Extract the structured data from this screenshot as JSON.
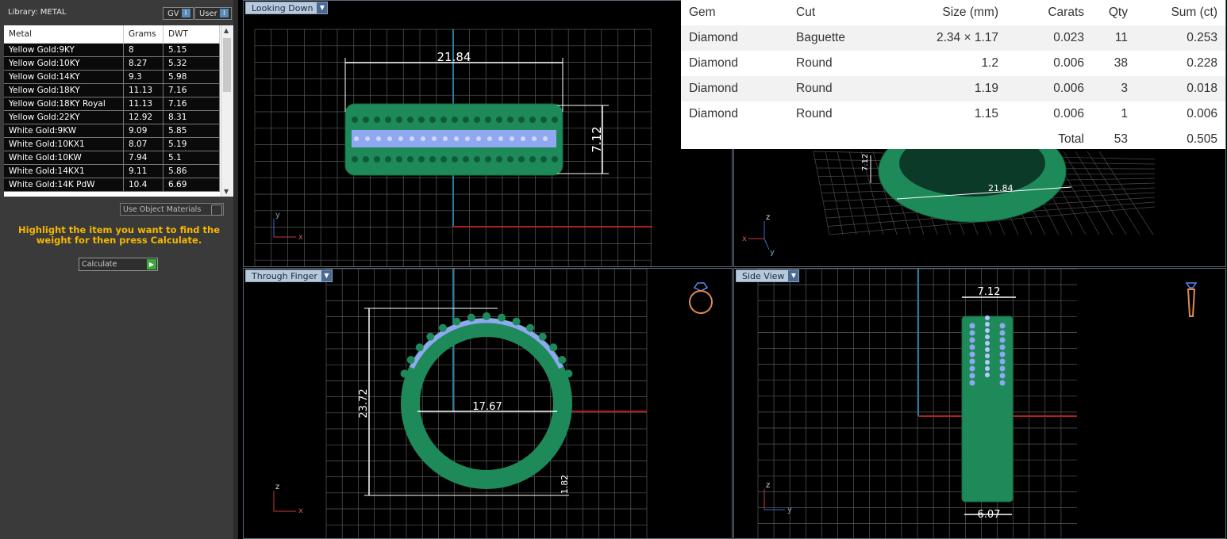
{
  "library": {
    "title": "Library: METAL",
    "gv_label": "GV",
    "user_label": "User",
    "toggle_mark": "I"
  },
  "metal_table": {
    "headers": [
      "Metal",
      "Grams",
      "DWT"
    ],
    "rows": [
      [
        "Yellow Gold:9KY",
        "8",
        "5.15"
      ],
      [
        "Yellow Gold:10KY",
        "8.27",
        "5.32"
      ],
      [
        "Yellow Gold:14KY",
        "9.3",
        "5.98"
      ],
      [
        "Yellow Gold:18KY",
        "11.13",
        "7.16"
      ],
      [
        "Yellow Gold:18KY Royal",
        "11.13",
        "7.16"
      ],
      [
        "Yellow Gold:22KY",
        "12.92",
        "8.31"
      ],
      [
        "White Gold:9KW",
        "9.09",
        "5.85"
      ],
      [
        "White Gold:10KX1",
        "8.07",
        "5.19"
      ],
      [
        "White Gold:10KW",
        "7.94",
        "5.1"
      ],
      [
        "White Gold:14KX1",
        "9.11",
        "5.86"
      ],
      [
        "White Gold:14K PdW",
        "10.4",
        "6.69"
      ]
    ]
  },
  "use_object_materials": "Use Object Materials",
  "hint": "Highlight the item you want to find the weight for then press Calculate.",
  "calculate_label": "Calculate",
  "viewports": {
    "top_left": {
      "label": "Looking Down",
      "dim_width": "21.84",
      "dim_height": "7.12"
    },
    "top_right": {
      "dim_width": "21.84",
      "dim_height": "7.12"
    },
    "bottom_left": {
      "label": "Through Finger",
      "dim_height": "23.72",
      "dim_inner": "17.67",
      "dim_thick": "1.82"
    },
    "bottom_right": {
      "label": "Side View",
      "dim_top": "7.12",
      "dim_bottom": "6.07"
    }
  },
  "axis_labels": {
    "x": "x",
    "y": "y",
    "z": "z"
  },
  "gem_table": {
    "headers": [
      "Gem",
      "Cut",
      "Size (mm)",
      "Carats",
      "Qty",
      "Sum (ct)"
    ],
    "rows": [
      [
        "Diamond",
        "Baguette",
        "2.34 × 1.17",
        "0.023",
        "11",
        "0.253"
      ],
      [
        "Diamond",
        "Round",
        "1.2",
        "0.006",
        "38",
        "0.228"
      ],
      [
        "Diamond",
        "Round",
        "1.19",
        "0.006",
        "3",
        "0.018"
      ],
      [
        "Diamond",
        "Round",
        "1.15",
        "0.006",
        "1",
        "0.006"
      ]
    ],
    "total_label": "Total",
    "total_qty": "53",
    "total_sum": "0.505"
  },
  "colors": {
    "ring_green": "#1e8a5a",
    "gem_blue": "#8fa8f0",
    "grid": "#5a5a5a",
    "axis_red": "#b02020",
    "axis_blue": "#2a7a9a"
  }
}
